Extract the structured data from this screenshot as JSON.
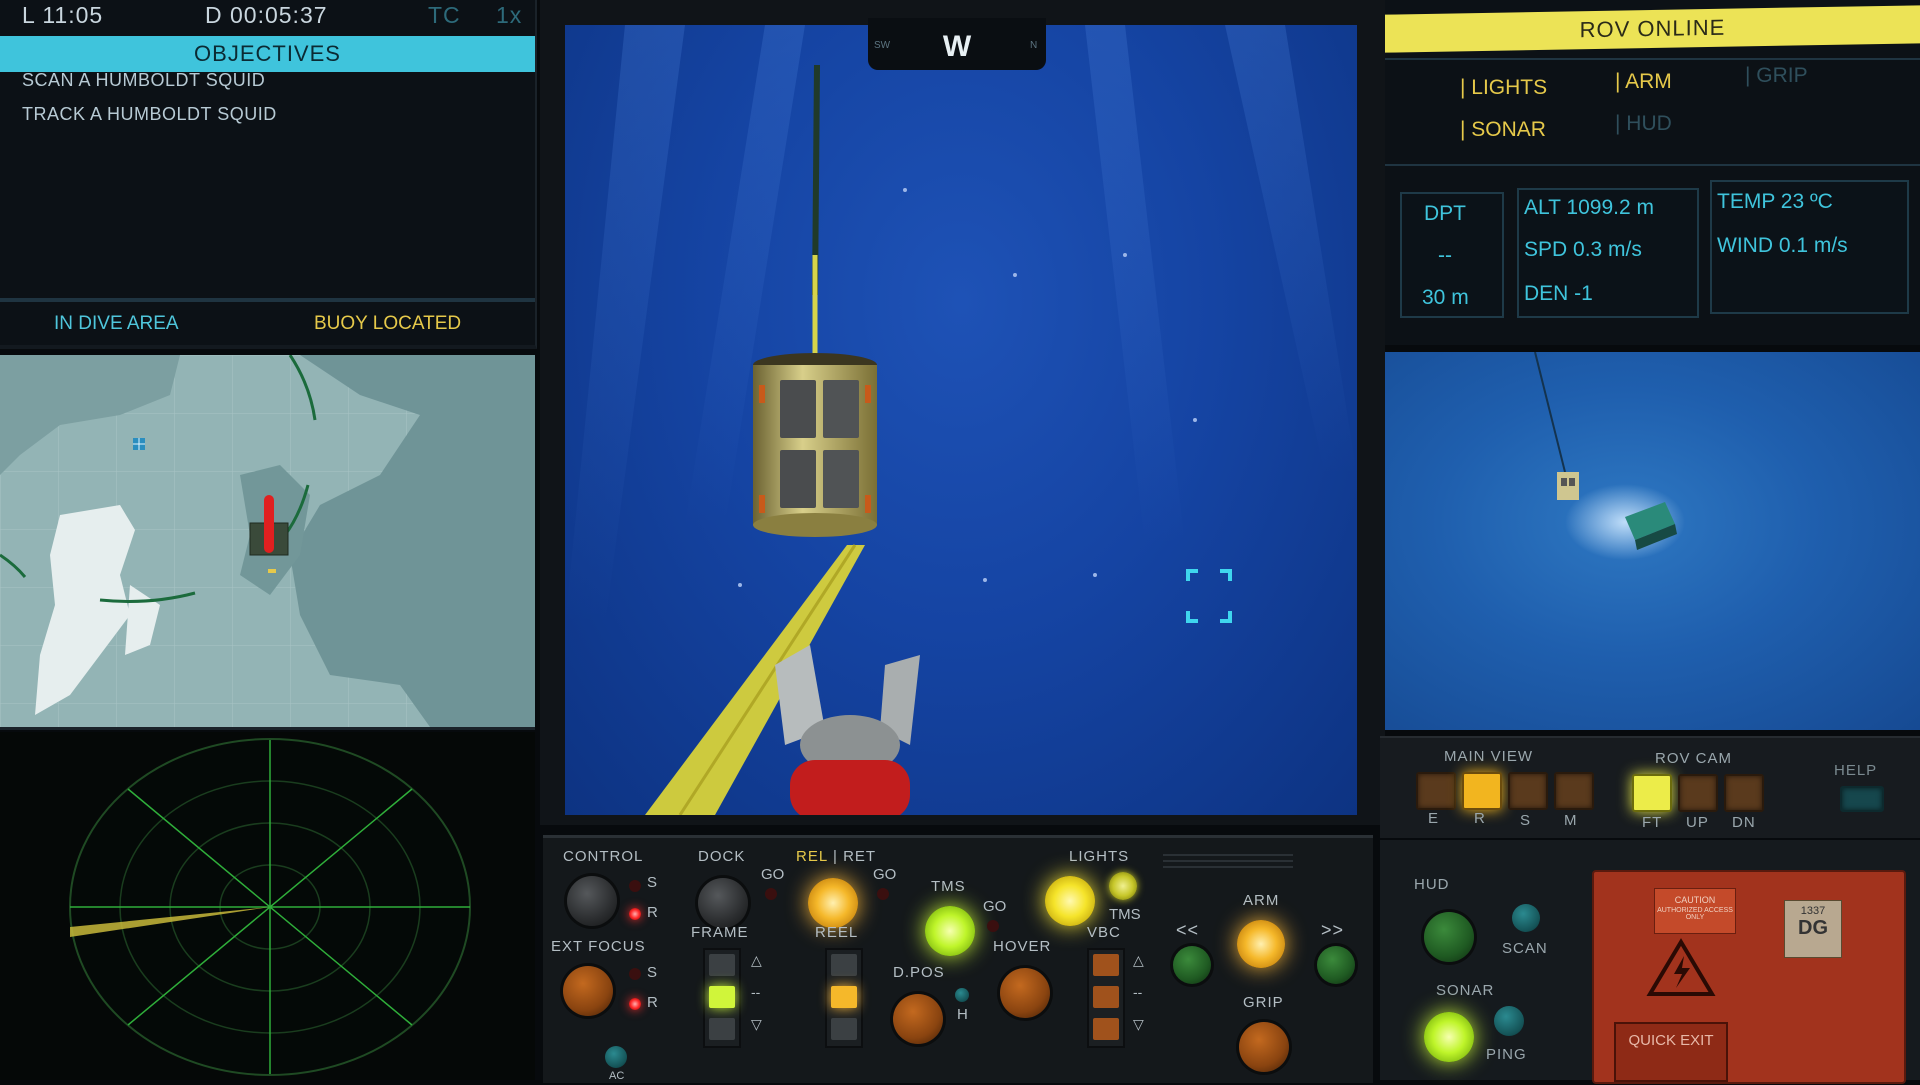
{
  "hud": {
    "local_time": "L 11:05",
    "dive_time": "D 00:05:37",
    "tc": "TC",
    "speed": "1x"
  },
  "objectives": {
    "header": "OBJECTIVES",
    "items": [
      "SCAN A HUMBOLDT SQUID",
      "TRACK A HUMBOLDT SQUID"
    ],
    "status_dive": "IN DIVE AREA",
    "status_buoy": "BUOY LOCATED"
  },
  "compass": {
    "heading": "W",
    "left_tick": "SW",
    "right_tick": "N"
  },
  "rov": {
    "header": "ROV ONLINE",
    "systems": [
      {
        "label": "| LIGHTS",
        "active": true
      },
      {
        "label": "| ARM",
        "active": true
      },
      {
        "label": "| GRIP",
        "active": false
      },
      {
        "label": "| SONAR",
        "active": true
      },
      {
        "label": "| HUD",
        "active": false
      }
    ],
    "depth": {
      "label": "DPT",
      "value": "--",
      "target": "30 m"
    },
    "alt": "ALT 1099.2 m",
    "spd": "SPD 0.3 m/s",
    "den": "DEN -1",
    "temp": "TEMP 23 ºC",
    "wind": "WIND 0.1 m/s"
  },
  "view_panel": {
    "main_view_label": "MAIN VIEW",
    "main_view_options": [
      "E",
      "R",
      "S",
      "M"
    ],
    "main_view_selected": "R",
    "rov_cam_label": "ROV CAM",
    "rov_cam_options": [
      "FT",
      "UP",
      "DN"
    ],
    "rov_cam_selected": "FT",
    "help_label": "HELP"
  },
  "control_desk": {
    "control": "CONTROL",
    "s": "S",
    "r": "R",
    "dock": "DOCK",
    "go": "GO",
    "rel": "REL",
    "ret": "| RET",
    "tms": "TMS",
    "lights": "LIGHTS",
    "ext_focus": "EXT FOCUS",
    "ac": "AC",
    "frame": "FRAME",
    "reel": "REEL",
    "dpos": "D.POS",
    "h": "H",
    "hover": "HOVER",
    "vbc": "VBC",
    "arm": "ARM",
    "grip": "GRIP",
    "prev": "<<",
    "next": ">>",
    "up_arrow": "△",
    "dash": "--",
    "down_arrow": "▽"
  },
  "hud_panel": {
    "hud": "HUD",
    "scan": "SCAN",
    "sonar": "SONAR",
    "ping": "PING",
    "caution": "CAUTION",
    "authorized": "AUTHORIZED ACCESS ONLY",
    "code_number": "1337",
    "code_letters": "DG",
    "quick_exit": "QUICK EXIT"
  },
  "colors": {
    "accent_cyan": "#3fc4dc",
    "accent_yellow": "#e6c94a",
    "rov_header": "#ece356",
    "water": "#1544a3"
  }
}
